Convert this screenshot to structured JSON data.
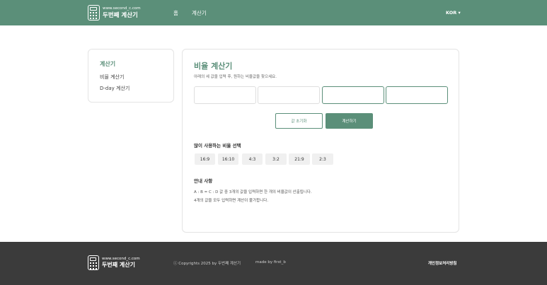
{
  "header": {
    "logo_small": "www.second_c.com",
    "logo_big": "두번째 계산기",
    "nav_home": "홈",
    "nav_calc": "계산기",
    "lang": "KOR ▾"
  },
  "sidebar": {
    "title": "계산기",
    "items": [
      "비율 계산기",
      "D-day 계산기"
    ]
  },
  "main": {
    "title": "비율 계산기",
    "subtitle": "아래의 세 값을 입력 후, 원하는 비율값을 찾으세요.",
    "inputs": [
      {
        "value": "",
        "placeholder": ""
      },
      {
        "value": "",
        "placeholder": ""
      },
      {
        "value": "",
        "placeholder": ""
      },
      {
        "value": "",
        "placeholder": ""
      }
    ],
    "reset_label": "값 초기화",
    "calc_label": "계산하기",
    "ratio_section_title": "많이 사용하는 비율 선택",
    "ratios": [
      "16:9",
      "16:10",
      "4:3",
      "3:2",
      "21:9",
      "2:3"
    ],
    "guide_title": "안내 사항",
    "guide_lines": [
      "A : B = C : D 값 중 3개의 값을 입력하면 한 개의 비율값이 산출됩니다.",
      "4개의 값을 모두 입력하면 계산이 불가합니다."
    ]
  },
  "footer": {
    "logo_small": "www.second_c.com",
    "logo_big": "두번째 계산기",
    "copyright": "ⓒ Copyrights 2025 by 두번째 계산기",
    "made_by": "made by first_b",
    "privacy": "개인정보처리방침"
  },
  "colors": {
    "accent": "#5b8f79",
    "footer_bg": "#3b3b3b",
    "chip_bg": "#f0f0f0"
  },
  "icons": {
    "logo": "calculator-icon"
  }
}
